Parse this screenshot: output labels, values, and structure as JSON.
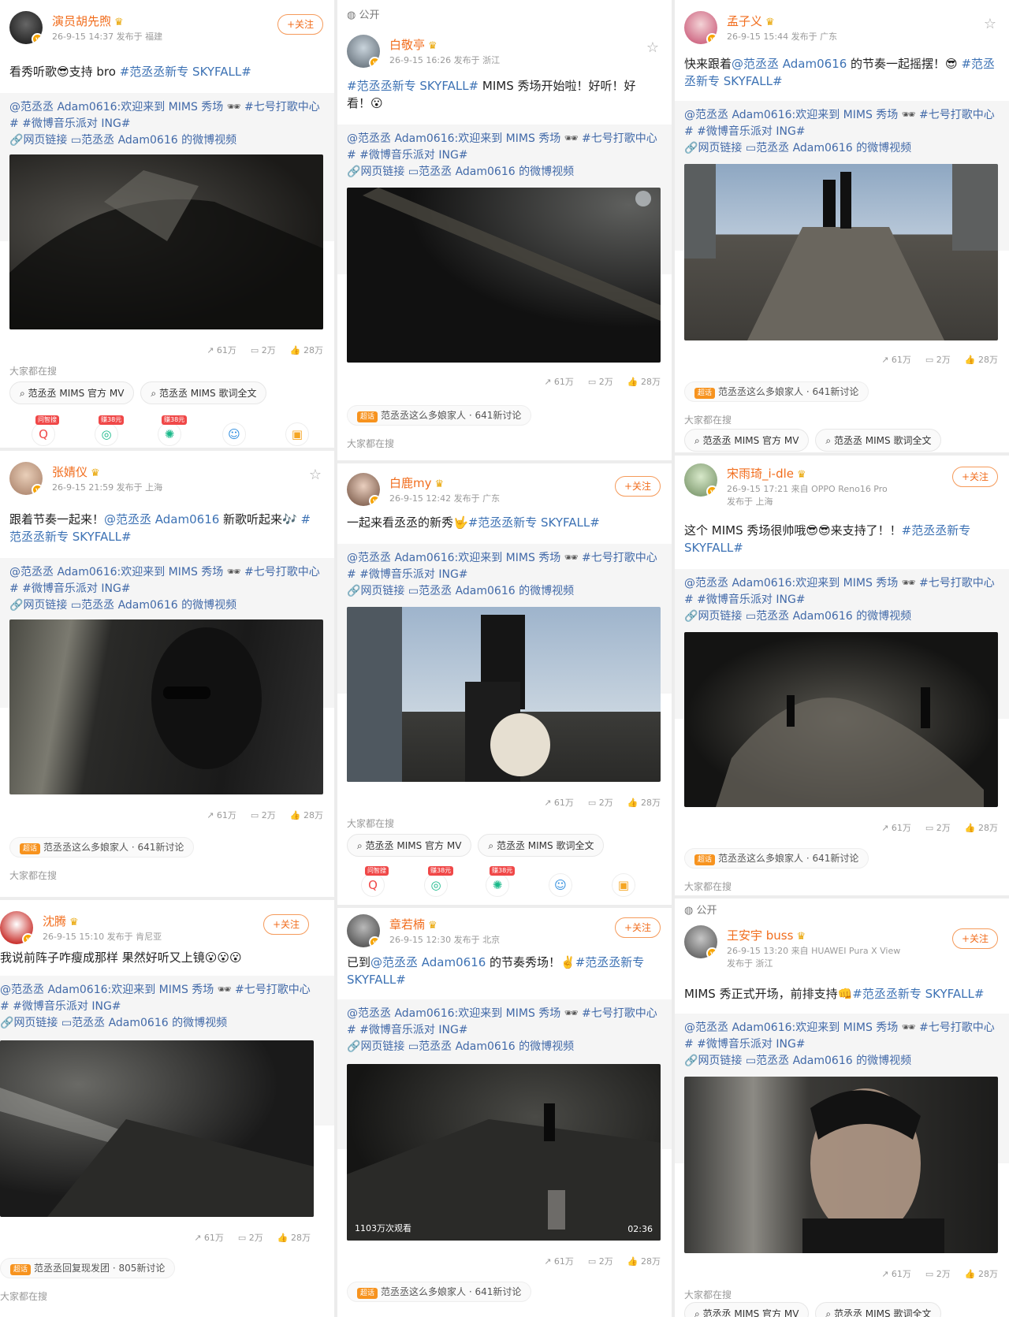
{
  "common": {
    "repost_line1_a": "@范丞丞 Adam0616:欢迎来到 MIMS 秀场",
    "repost_line1_b": " #七号打歌中心",
    "repost_line2": "#  #微博音乐派对 ING#",
    "repost_line3_a": "网页链接",
    "repost_line3_b": "范丞丞 Adam0616 的微博视频",
    "stat_share": "61万",
    "stat_comment": "2万",
    "stat_like": "28万",
    "everyone_searching": "大家都在搜",
    "search1": "范丞丞 MIMS 官方 MV",
    "search2": "范丞丞 MIMS 歌词全文",
    "follow": "+关注",
    "public": "公开",
    "hot_badge": "超话",
    "hot_topic1": "范丞丞这么多娘家人 · 641新讨论",
    "hot_topic2": "范丞丞回复现发团 · 805新讨论",
    "app_badge1": "问智搜",
    "app_badge2": "赚38元",
    "app_badge3": "赚38元"
  },
  "posts": [
    {
      "name": "演员胡先煦",
      "meta": "26-9-15 14:37  发布于 福建",
      "text_a": "看秀听歌😎支持 bro ",
      "text_tag": "#范丞丞新专 SKYFALL#"
    },
    {
      "name": "白敬亭",
      "meta": "26-9-15 16:26  发布于 浙江",
      "text_tag": "#范丞丞新专 SKYFALL#",
      "text_a": " MIMS 秀场开始啦！好听！好看！😮"
    },
    {
      "name": "孟子义",
      "meta": "26-9-15 15:44  发布于 广东",
      "text_a": "快来跟着",
      "text_tag_mid": "@范丞丞 Adam0616",
      "text_b": " 的节奏一起摇摆！😎 ",
      "text_tag": "#范丞丞新专 SKYFALL#"
    },
    {
      "name": "张婧仪",
      "meta": "26-9-15 21:59  发布于 上海",
      "text_a": "跟着节奏一起来！",
      "text_tag_mid": "@范丞丞 Adam0616",
      "text_b": " 新歌听起来🎶 ",
      "text_tag": "#范丞丞新专 SKYFALL#"
    },
    {
      "name": "白鹿my",
      "meta": "26-9-15 12:42  发布于 广东",
      "text_a": "一起来看丞丞的新秀🤟",
      "text_tag": "#范丞丞新专 SKYFALL#"
    },
    {
      "name": "宋雨琦_i-dle",
      "meta": "26-9-15 17:21  来自 OPPO Reno16 Pro",
      "meta2": "发布于 上海",
      "text_a": "这个 MIMS 秀场很帅哦😎😎来支持了！！",
      "text_tag": "#范丞丞新专 SKYFALL#"
    },
    {
      "name": "沈腾",
      "meta": "26-9-15 15:10  发布于 肯尼亚",
      "text_a": "我说前阵子咋瘦成那样 果然好听又上镜😮😮😮"
    },
    {
      "name": "章若楠",
      "meta": "26-9-15 12:30  发布于 北京",
      "text_a": "已到",
      "text_tag_mid": "@范丞丞 Adam0616",
      "text_b": " 的节奏秀场！✌️",
      "text_tag": "#范丞丞新专 SKYFALL#",
      "video_views": "1103万次观看",
      "video_duration": "02:36"
    },
    {
      "name": "王安宇 buss",
      "meta": "26-9-15 13:20  来自 HUAWEI Pura X View",
      "meta2": "发布于 浙江",
      "text_a": "MIMS 秀正式开场，前排支持👊",
      "text_tag": "#范丞丞新专 SKYFALL#"
    }
  ],
  "colors": {
    "username": "#f16d1d",
    "link": "#3d72b4",
    "accent_badge": "#f7931e"
  }
}
